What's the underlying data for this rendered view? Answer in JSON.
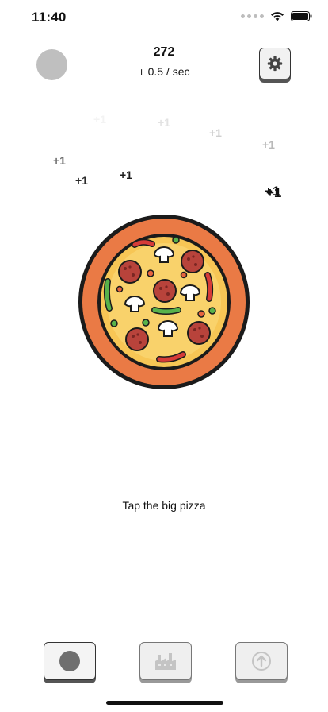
{
  "status": {
    "time": "11:40"
  },
  "score": {
    "count": "272",
    "rate": "+ 0.5 / sec"
  },
  "floating": [
    {
      "text": "+1",
      "color": "#f3f3f3"
    },
    {
      "text": "+1",
      "color": "#e2e2e2"
    },
    {
      "text": "+1",
      "color": "#cfcfcf"
    },
    {
      "text": "+1",
      "color": "#b9b9b9"
    },
    {
      "text": "+1",
      "color": "#6e6e6e"
    },
    {
      "text": "+1",
      "color": "#1e1e1e"
    },
    {
      "text": "+1",
      "color": "#2a2a2a"
    },
    {
      "text": "+1",
      "color": "#111111"
    },
    {
      "text": "+1",
      "color": "#111111"
    }
  ],
  "hint": "Tap the big pizza",
  "icons": {
    "settings": "gear-icon",
    "pizza": "pizza-icon",
    "shop": "circle-icon",
    "factory": "factory-icon",
    "upgrade": "arrow-up-circle-icon"
  }
}
